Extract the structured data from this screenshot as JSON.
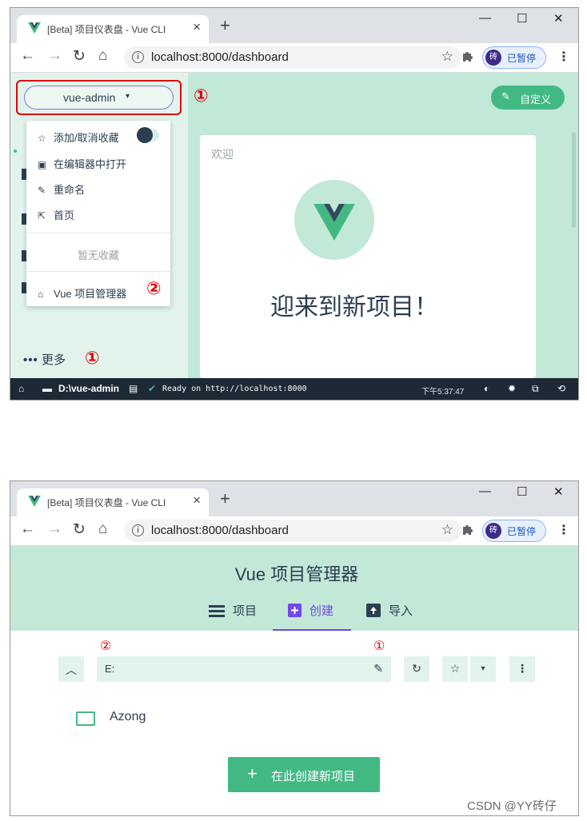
{
  "browser": {
    "tab_title": "[Beta] 项目仪表盘 - Vue CLI",
    "tab_close": "×",
    "new_tab": "+",
    "window_controls": {
      "minimize": "—",
      "maximize": "☐",
      "close": "✕"
    },
    "nav": {
      "back": "←",
      "forward": "→",
      "reload": "↻",
      "home": "⌂"
    },
    "info_icon": "i",
    "url": "localhost:8000/dashboard",
    "bookmark_star": "☆",
    "extensions_icon": "puzzle-icon",
    "profile": {
      "avatar_text": "砖",
      "status": "已暂停"
    },
    "menu": "⋮"
  },
  "window1": {
    "project_selector": {
      "label": "vue-admin",
      "caret": "▾"
    },
    "annotation_1": "①",
    "dropdown": {
      "items": [
        {
          "icon": "☆",
          "label": "添加/取消收藏"
        },
        {
          "icon": "▣",
          "label": "在编辑器中打开"
        },
        {
          "icon": "✎",
          "label": "重命名"
        },
        {
          "icon": "⇱",
          "label": "首页"
        }
      ],
      "empty_text": "暂无收藏",
      "manager": {
        "icon": "⌂",
        "label": "Vue 项目管理器"
      },
      "annotation_2": "②"
    },
    "more": {
      "dots": "•••",
      "label": "更多",
      "annotation": "①"
    },
    "customize_button": {
      "icon": "✎",
      "label": "自定义"
    },
    "welcome": {
      "heading": "欢迎",
      "message": "迎来到新项目！"
    },
    "statusbar": {
      "home_icon": "⌂",
      "folder_icon": "▬",
      "folder": "D:\\vue-admin",
      "log_icon": "▤",
      "log_check": "✔",
      "log": "Ready on http://localhost:8000",
      "time": "下午5:37:47",
      "icons": [
        "◐",
        "✹",
        "⧉",
        "⟲"
      ]
    },
    "colors": {
      "accent": "#42b983",
      "background": "#c2e8d8",
      "annotation": "#e30000",
      "statusbar": "#1d2935"
    }
  },
  "window2": {
    "title": "Vue 项目管理器",
    "tabs": [
      {
        "icon": "list-icon",
        "label": "项目"
      },
      {
        "icon": "plus-box-icon",
        "label": "创建",
        "active": true
      },
      {
        "icon": "import-icon",
        "label": "导入"
      }
    ],
    "annotation_1": "①",
    "annotation_2": "②",
    "path": {
      "up_icon": "︿",
      "value": "E:",
      "edit_icon": "✎",
      "refresh_icon": "↻",
      "star_icon": "☆",
      "caret_icon": "▾",
      "more_icon": "⋮"
    },
    "folder": {
      "name": "Azong"
    },
    "create_button": {
      "icon": "+",
      "label": "在此创建新项目"
    },
    "colors": {
      "active_tab": "#7048e8",
      "accent": "#42b983"
    }
  },
  "watermark": "CSDN @YY砖仔"
}
